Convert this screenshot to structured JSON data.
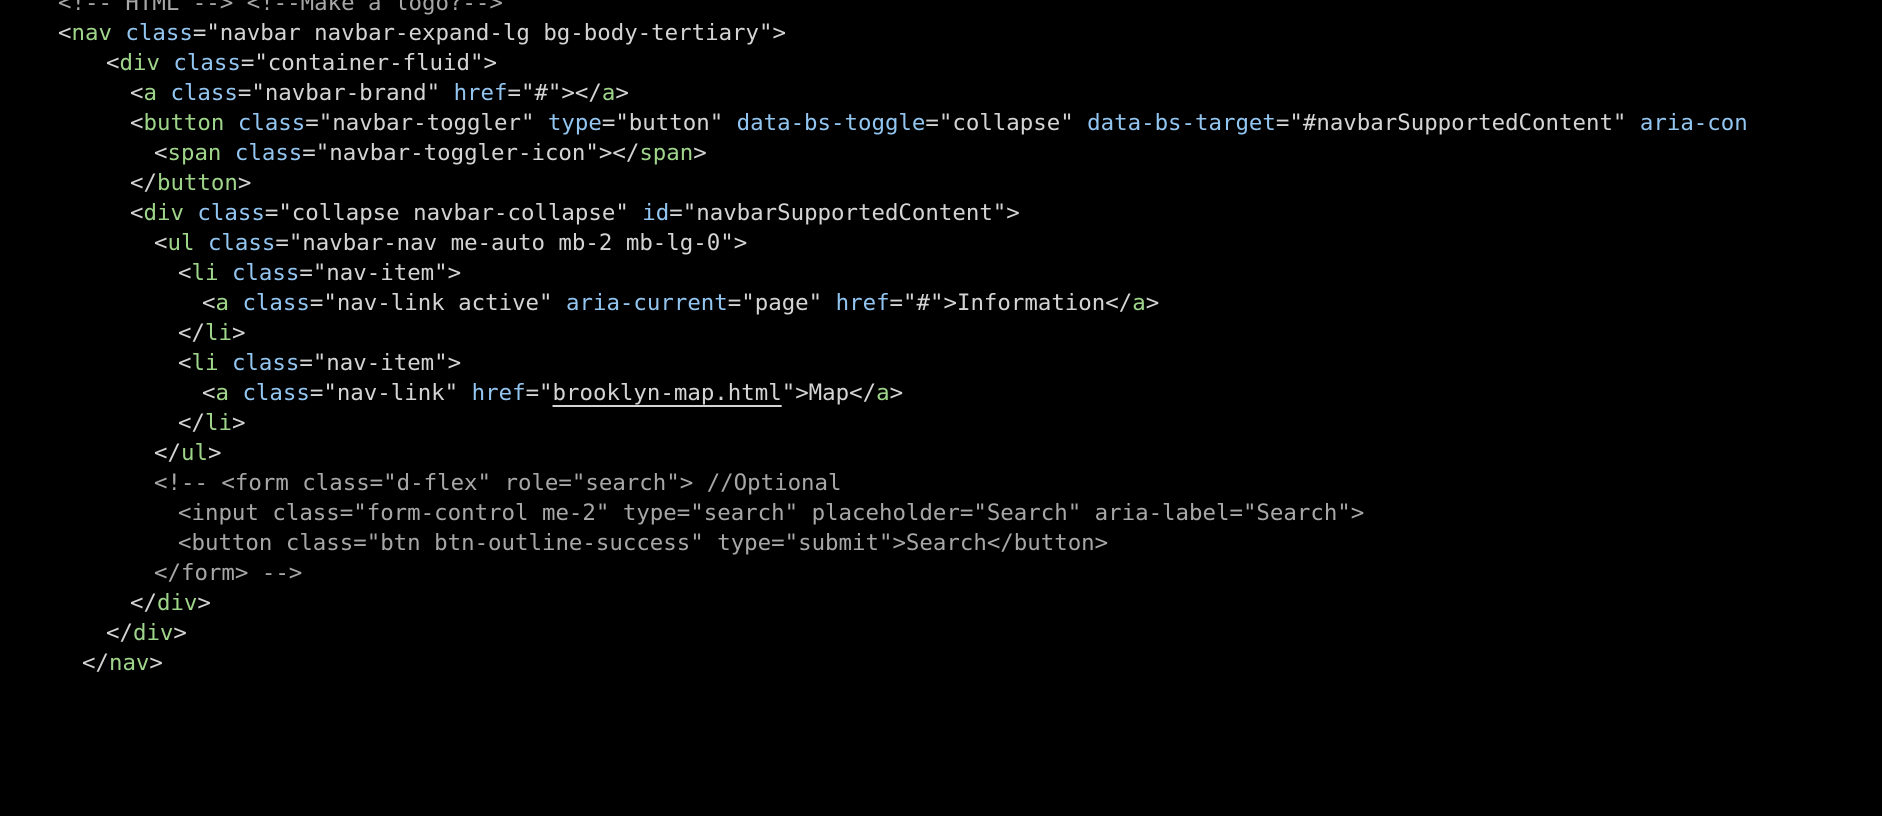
{
  "editor": {
    "language": "html",
    "theme": "dark",
    "colors": {
      "background": "#000000",
      "punct": "#d4d4d4",
      "tag": "#9fd58a",
      "attr": "#92c5f0",
      "string": "#d4d4d4",
      "text": "#d4d4d4",
      "comment": "#a7a7a7"
    },
    "lines": [
      {
        "tokens": [
          {
            "t": "comment",
            "v": "<!-- HTML --> <!--Make a logo?-->"
          }
        ]
      },
      {
        "tokens": [
          {
            "t": "punct",
            "v": "<"
          },
          {
            "t": "tag",
            "v": "nav"
          },
          {
            "t": "punct",
            "v": " "
          },
          {
            "t": "attr",
            "v": "class"
          },
          {
            "t": "punct",
            "v": "="
          },
          {
            "t": "string",
            "v": "\"navbar navbar-expand-lg bg-body-tertiary\""
          },
          {
            "t": "punct",
            "v": ">"
          }
        ]
      },
      {
        "tokens": [
          {
            "t": "punct",
            "v": "<"
          },
          {
            "t": "tag",
            "v": "div"
          },
          {
            "t": "punct",
            "v": " "
          },
          {
            "t": "attr",
            "v": "class"
          },
          {
            "t": "punct",
            "v": "="
          },
          {
            "t": "string",
            "v": "\"container-fluid\""
          },
          {
            "t": "punct",
            "v": ">"
          }
        ]
      },
      {
        "tokens": [
          {
            "t": "punct",
            "v": "<"
          },
          {
            "t": "tag",
            "v": "a"
          },
          {
            "t": "punct",
            "v": " "
          },
          {
            "t": "attr",
            "v": "class"
          },
          {
            "t": "punct",
            "v": "="
          },
          {
            "t": "string",
            "v": "\"navbar-brand\""
          },
          {
            "t": "punct",
            "v": " "
          },
          {
            "t": "attr",
            "v": "href"
          },
          {
            "t": "punct",
            "v": "="
          },
          {
            "t": "string",
            "v": "\"#\""
          },
          {
            "t": "punct",
            "v": "></"
          },
          {
            "t": "tag",
            "v": "a"
          },
          {
            "t": "punct",
            "v": ">"
          }
        ]
      },
      {
        "tokens": [
          {
            "t": "punct",
            "v": "<"
          },
          {
            "t": "tag",
            "v": "button"
          },
          {
            "t": "punct",
            "v": " "
          },
          {
            "t": "attr",
            "v": "class"
          },
          {
            "t": "punct",
            "v": "="
          },
          {
            "t": "string",
            "v": "\"navbar-toggler\""
          },
          {
            "t": "punct",
            "v": " "
          },
          {
            "t": "attr",
            "v": "type"
          },
          {
            "t": "punct",
            "v": "="
          },
          {
            "t": "string",
            "v": "\"button\""
          },
          {
            "t": "punct",
            "v": " "
          },
          {
            "t": "attr",
            "v": "data-bs-toggle"
          },
          {
            "t": "punct",
            "v": "="
          },
          {
            "t": "string",
            "v": "\"collapse\""
          },
          {
            "t": "punct",
            "v": " "
          },
          {
            "t": "attr",
            "v": "data-bs-target"
          },
          {
            "t": "punct",
            "v": "="
          },
          {
            "t": "string",
            "v": "\"#navbarSupportedContent\""
          },
          {
            "t": "punct",
            "v": " "
          },
          {
            "t": "attr",
            "v": "aria-con"
          }
        ]
      },
      {
        "tokens": [
          {
            "t": "punct",
            "v": "<"
          },
          {
            "t": "tag",
            "v": "span"
          },
          {
            "t": "punct",
            "v": " "
          },
          {
            "t": "attr",
            "v": "class"
          },
          {
            "t": "punct",
            "v": "="
          },
          {
            "t": "string",
            "v": "\"navbar-toggler-icon\""
          },
          {
            "t": "punct",
            "v": "></"
          },
          {
            "t": "tag",
            "v": "span"
          },
          {
            "t": "punct",
            "v": ">"
          }
        ]
      },
      {
        "tokens": [
          {
            "t": "punct",
            "v": "</"
          },
          {
            "t": "tag",
            "v": "button"
          },
          {
            "t": "punct",
            "v": ">"
          }
        ]
      },
      {
        "tokens": [
          {
            "t": "punct",
            "v": "<"
          },
          {
            "t": "tag",
            "v": "div"
          },
          {
            "t": "punct",
            "v": " "
          },
          {
            "t": "attr",
            "v": "class"
          },
          {
            "t": "punct",
            "v": "="
          },
          {
            "t": "string",
            "v": "\"collapse navbar-collapse\""
          },
          {
            "t": "punct",
            "v": " "
          },
          {
            "t": "attr",
            "v": "id"
          },
          {
            "t": "punct",
            "v": "="
          },
          {
            "t": "string",
            "v": "\"navbarSupportedContent\""
          },
          {
            "t": "punct",
            "v": ">"
          }
        ]
      },
      {
        "tokens": [
          {
            "t": "punct",
            "v": "<"
          },
          {
            "t": "tag",
            "v": "ul"
          },
          {
            "t": "punct",
            "v": " "
          },
          {
            "t": "attr",
            "v": "class"
          },
          {
            "t": "punct",
            "v": "="
          },
          {
            "t": "string",
            "v": "\"navbar-nav me-auto mb-2 mb-lg-0\""
          },
          {
            "t": "punct",
            "v": ">"
          }
        ]
      },
      {
        "tokens": [
          {
            "t": "punct",
            "v": "<"
          },
          {
            "t": "tag",
            "v": "li"
          },
          {
            "t": "punct",
            "v": " "
          },
          {
            "t": "attr",
            "v": "class"
          },
          {
            "t": "punct",
            "v": "="
          },
          {
            "t": "string",
            "v": "\"nav-item\""
          },
          {
            "t": "punct",
            "v": ">"
          }
        ]
      },
      {
        "tokens": [
          {
            "t": "punct",
            "v": "<"
          },
          {
            "t": "tag",
            "v": "a"
          },
          {
            "t": "punct",
            "v": " "
          },
          {
            "t": "attr",
            "v": "class"
          },
          {
            "t": "punct",
            "v": "="
          },
          {
            "t": "string",
            "v": "\"nav-link active\""
          },
          {
            "t": "punct",
            "v": " "
          },
          {
            "t": "attr",
            "v": "aria-current"
          },
          {
            "t": "punct",
            "v": "="
          },
          {
            "t": "string",
            "v": "\"page\""
          },
          {
            "t": "punct",
            "v": " "
          },
          {
            "t": "attr",
            "v": "href"
          },
          {
            "t": "punct",
            "v": "="
          },
          {
            "t": "string",
            "v": "\"#\""
          },
          {
            "t": "punct",
            "v": ">"
          },
          {
            "t": "text",
            "v": "Information"
          },
          {
            "t": "punct",
            "v": "</"
          },
          {
            "t": "tag",
            "v": "a"
          },
          {
            "t": "punct",
            "v": ">"
          }
        ]
      },
      {
        "tokens": [
          {
            "t": "punct",
            "v": "</"
          },
          {
            "t": "tag",
            "v": "li"
          },
          {
            "t": "punct",
            "v": ">"
          }
        ]
      },
      {
        "tokens": [
          {
            "t": "punct",
            "v": "<"
          },
          {
            "t": "tag",
            "v": "li"
          },
          {
            "t": "punct",
            "v": " "
          },
          {
            "t": "attr",
            "v": "class"
          },
          {
            "t": "punct",
            "v": "="
          },
          {
            "t": "string",
            "v": "\"nav-item\""
          },
          {
            "t": "punct",
            "v": ">"
          }
        ]
      },
      {
        "tokens": [
          {
            "t": "punct",
            "v": "<"
          },
          {
            "t": "tag",
            "v": "a"
          },
          {
            "t": "punct",
            "v": " "
          },
          {
            "t": "attr",
            "v": "class"
          },
          {
            "t": "punct",
            "v": "="
          },
          {
            "t": "string",
            "v": "\"nav-link\""
          },
          {
            "t": "punct",
            "v": " "
          },
          {
            "t": "attr",
            "v": "href"
          },
          {
            "t": "punct",
            "v": "="
          },
          {
            "t": "string",
            "v": "\""
          },
          {
            "t": "link",
            "v": "brooklyn-map.html"
          },
          {
            "t": "string",
            "v": "\""
          },
          {
            "t": "punct",
            "v": ">"
          },
          {
            "t": "text",
            "v": "Map"
          },
          {
            "t": "punct",
            "v": "</"
          },
          {
            "t": "tag",
            "v": "a"
          },
          {
            "t": "punct",
            "v": ">"
          }
        ]
      },
      {
        "tokens": [
          {
            "t": "punct",
            "v": "</"
          },
          {
            "t": "tag",
            "v": "li"
          },
          {
            "t": "punct",
            "v": ">"
          }
        ]
      },
      {
        "tokens": [
          {
            "t": "punct",
            "v": "</"
          },
          {
            "t": "tag",
            "v": "ul"
          },
          {
            "t": "punct",
            "v": ">"
          }
        ]
      },
      {
        "tokens": [
          {
            "t": "comment",
            "v": "<!-- <form class=\"d-flex\" role=\"search\"> //Optional"
          }
        ]
      },
      {
        "tokens": [
          {
            "t": "comment",
            "v": "<input class=\"form-control me-2\" type=\"search\" placeholder=\"Search\" aria-label=\"Search\">"
          }
        ]
      },
      {
        "tokens": [
          {
            "t": "comment",
            "v": "<button class=\"btn btn-outline-success\" type=\"submit\">Search</button>"
          }
        ]
      },
      {
        "tokens": [
          {
            "t": "comment",
            "v": "</form> -->"
          }
        ]
      },
      {
        "tokens": [
          {
            "t": "punct",
            "v": "</"
          },
          {
            "t": "tag",
            "v": "div"
          },
          {
            "t": "punct",
            "v": ">"
          }
        ]
      },
      {
        "tokens": [
          {
            "t": "punct",
            "v": "</"
          },
          {
            "t": "tag",
            "v": "div"
          },
          {
            "t": "punct",
            "v": ">"
          }
        ]
      },
      {
        "tokens": [
          {
            "t": "punct",
            "v": "</"
          },
          {
            "t": "tag",
            "v": "nav"
          },
          {
            "t": "punct",
            "v": ">"
          }
        ]
      }
    ]
  }
}
